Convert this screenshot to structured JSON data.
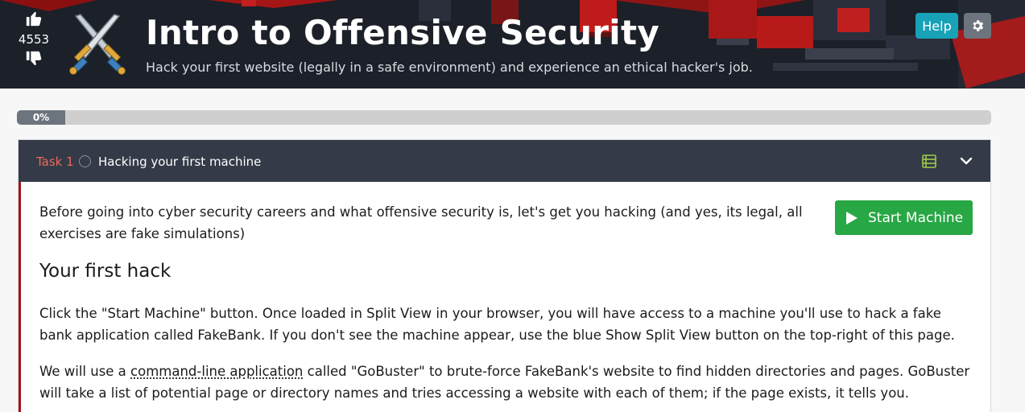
{
  "room": {
    "votes": "4553",
    "title": "Intro to Offensive Security",
    "subtitle": "Hack your first website (legally in a safe environment) and experience an ethical hacker's job."
  },
  "header_buttons": {
    "help_label": "Help",
    "settings_icon": "gear-icon"
  },
  "progress": {
    "label": "0%",
    "value": 0
  },
  "task": {
    "label": "Task 1",
    "title": "Hacking your first machine",
    "start_button": "Start Machine",
    "intro": "Before going into cyber security careers and what offensive security is, let's get you hacking (and yes, its legal, all exercises are fake simulations)",
    "heading": "Your first hack",
    "paragraph1": "Click the \"Start Machine\" button. Once loaded in Split View in your browser, you will have access to a machine you'll use to hack a fake bank application called FakeBank. If you don't see the machine appear, use the blue Show Split View button on the top-right of this page.",
    "paragraph2_pre": "We will use a ",
    "paragraph2_link": "command-line application",
    "paragraph2_post": " called \"GoBuster\" to brute-force FakeBank's website to find hidden directories and pages. GoBuster will take a list of potential page or directory names and tries accessing a website with each of them; if the page exists, it tells you."
  },
  "colors": {
    "banner_bg": "#1c2029",
    "help_button": "#17a2b8",
    "start_button": "#28a745",
    "task_label": "#ea6a5b",
    "task_border": "#a31616",
    "tools_icon": "#a2c94a"
  }
}
